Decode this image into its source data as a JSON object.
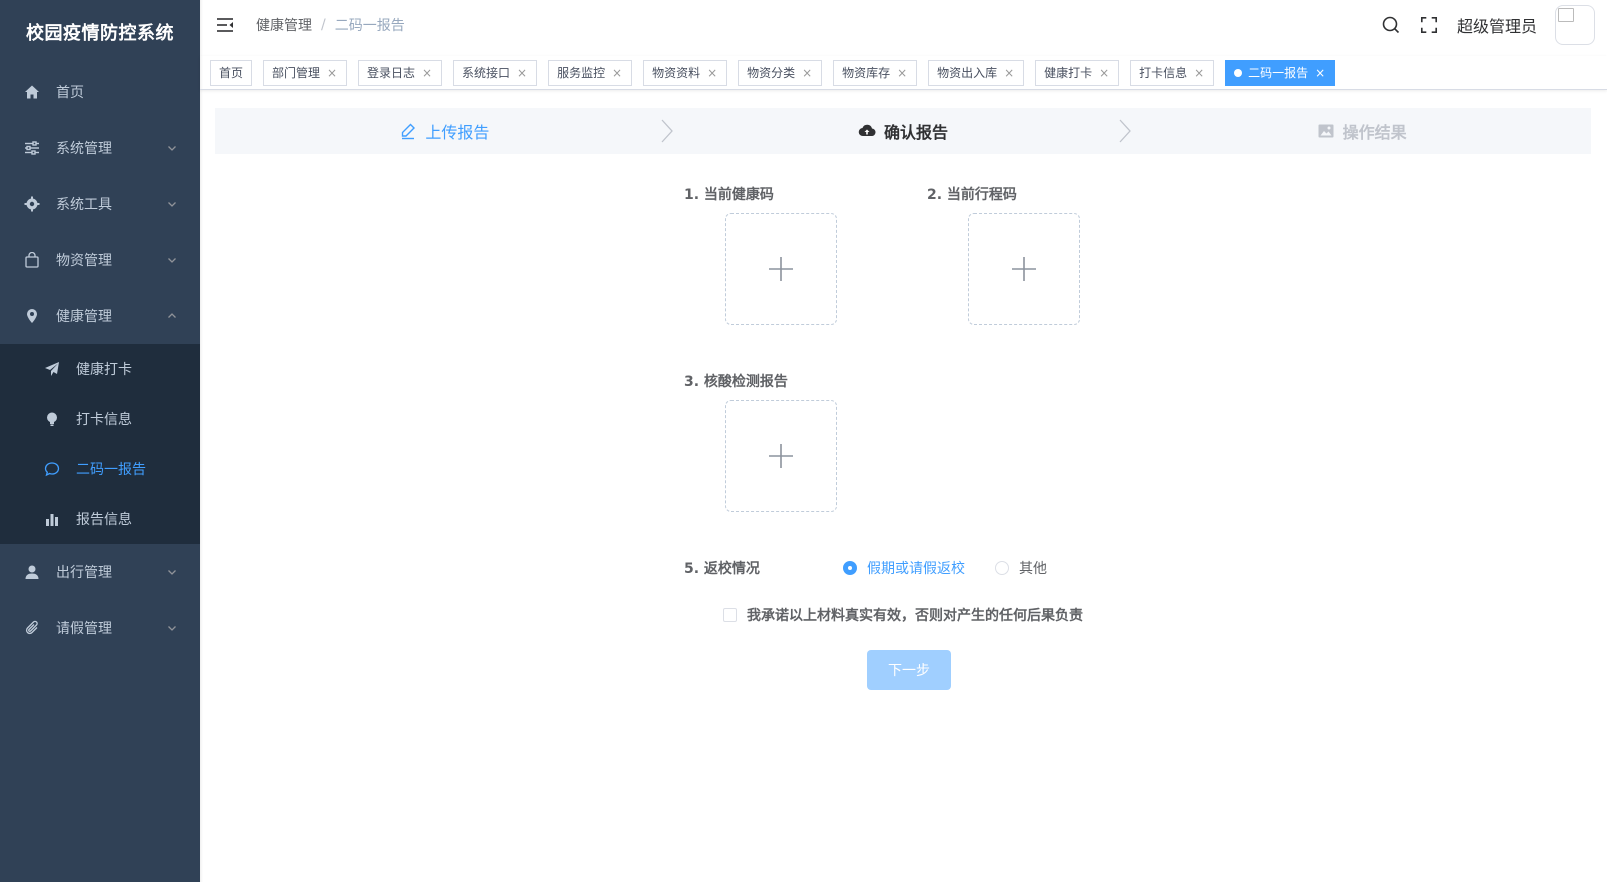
{
  "app": {
    "title": "校园疫情防控系统"
  },
  "sidebar": {
    "items": [
      {
        "label": "首页",
        "icon": "home-icon"
      },
      {
        "label": "系统管理",
        "icon": "sliders-icon"
      },
      {
        "label": "系统工具",
        "icon": "gear-icon"
      },
      {
        "label": "物资管理",
        "icon": "bag-icon"
      },
      {
        "label": "健康管理",
        "icon": "location-icon",
        "expanded": true
      }
    ],
    "health_sub": [
      {
        "label": "健康打卡",
        "icon": "send-icon"
      },
      {
        "label": "打卡信息",
        "icon": "bulb-icon"
      },
      {
        "label": "二码一报告",
        "icon": "chat-icon",
        "active": true
      },
      {
        "label": "报告信息",
        "icon": "bar-chart-icon"
      }
    ],
    "items_after": [
      {
        "label": "出行管理",
        "icon": "user-icon"
      },
      {
        "label": "请假管理",
        "icon": "paperclip-icon"
      }
    ]
  },
  "navbar": {
    "breadcrumb": [
      "健康管理",
      "二码一报告"
    ],
    "separator": "/",
    "username": "超级管理员"
  },
  "tags": [
    "首页",
    "部门管理",
    "登录日志",
    "系统接口",
    "服务监控",
    "物资资料",
    "物资分类",
    "物资库存",
    "物资出入库",
    "健康打卡",
    "打卡信息",
    "二码一报告"
  ],
  "steps": [
    {
      "label": "上传报告",
      "status": "finish",
      "icon": "edit-icon"
    },
    {
      "label": "确认报告",
      "status": "process",
      "icon": "upload-cloud-icon"
    },
    {
      "label": "操作结果",
      "status": "wait",
      "icon": "picture-icon"
    }
  ],
  "form": {
    "health_code_label": "1. 当前健康码",
    "trip_code_label": "2. 当前行程码",
    "nucleic_label": "3. 核酸检测报告",
    "return_label": "5. 返校情况",
    "radio_options": [
      "假期或请假返校",
      "其他"
    ],
    "radio_selected": "假期或请假返校",
    "promise_text": "我承诺以上材料真实有效，否则对产生的任何后果负责",
    "promise_checked": false,
    "next_label": "下一步"
  },
  "colors": {
    "sidebar_bg": "#304156",
    "submenu_bg": "#1f2d3d",
    "primary": "#409eff",
    "disabled_btn": "#a0cfff"
  }
}
